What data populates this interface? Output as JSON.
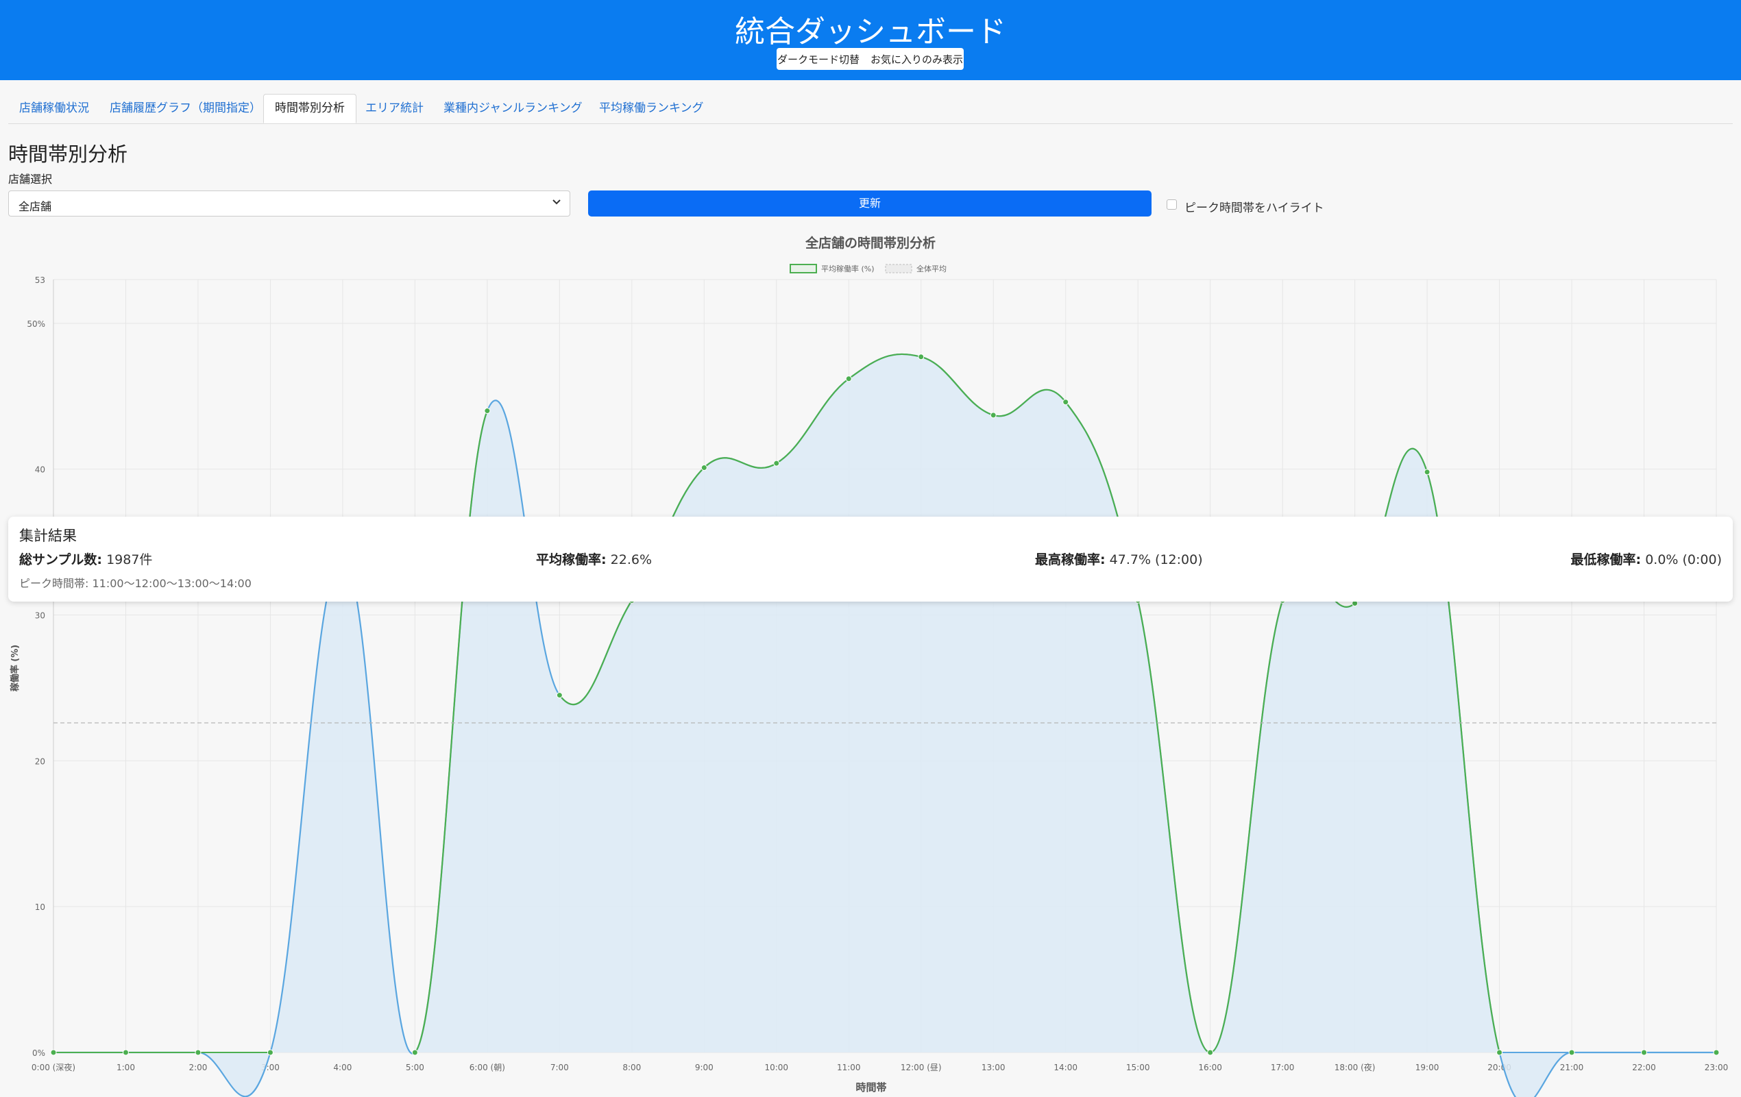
{
  "header": {
    "title": "統合ダッシュボード",
    "dark_mode_label": "ダークモード切替",
    "favorites_label": "お気に入りのみ表示"
  },
  "tabs": [
    {
      "label": "店舗稼働状況",
      "active": false
    },
    {
      "label": "店舗履歴グラフ（期間指定）",
      "active": false
    },
    {
      "label": "時間帯別分析",
      "active": true
    },
    {
      "label": "エリア統計",
      "active": false
    },
    {
      "label": "業種内ジャンルランキング",
      "active": false
    },
    {
      "label": "平均稼働ランキング",
      "active": false
    }
  ],
  "section": {
    "title": "時間帯別分析",
    "store_select_label": "店舗選択",
    "store_select_value": "全店舗",
    "update_button": "更新",
    "peak_highlight_label": "ピーク時間帯をハイライト",
    "peak_highlight_checked": false
  },
  "colors": {
    "header_bg": "#0a7cf0",
    "button_bg": "#0a6cf5",
    "line_green": "#4caf50",
    "line_blue": "#5aa6e0",
    "fill": "#dceaf6"
  },
  "chart_data": {
    "type": "line",
    "title": "全店舗の時間帯別分析",
    "xlabel": "時間帯",
    "ylabel": "稼働率 (%)",
    "x_tick_labels": [
      "0:00 (深夜)",
      "1:00",
      "2:00",
      "3:00",
      "4:00",
      "5:00",
      "6:00 (朝)",
      "7:00",
      "8:00",
      "9:00",
      "10:00",
      "11:00",
      "12:00 (昼)",
      "13:00",
      "14:00",
      "15:00",
      "16:00",
      "17:00",
      "18:00 (夜)",
      "19:00",
      "20:00",
      "21:00",
      "22:00",
      "23:00"
    ],
    "y_tick_labels": [
      {
        "value": 0,
        "label": "0%"
      },
      {
        "value": 10,
        "label": "10"
      },
      {
        "value": 20,
        "label": "20"
      },
      {
        "value": 30,
        "label": "30"
      },
      {
        "value": 40,
        "label": "40"
      },
      {
        "value": 50,
        "label": "50%"
      },
      {
        "value": 53,
        "label": "53"
      }
    ],
    "ylim": [
      0,
      53
    ],
    "series": [
      {
        "name": "平均稼働率 (%)",
        "values": [
          0,
          0,
          0,
          0,
          34,
          0,
          44,
          24.5,
          31,
          40.1,
          40.4,
          46.2,
          47.7,
          43.7,
          44.6,
          31,
          0,
          31,
          30.8,
          39.8,
          0,
          0,
          0,
          0
        ]
      }
    ],
    "reference_lines": [
      {
        "name": "全体平均",
        "value": 22.6
      }
    ],
    "legend_position": "top",
    "grid": true
  },
  "summary": {
    "title": "集計結果",
    "total_samples_label": "総サンプル数:",
    "total_samples_value": "1987件",
    "avg_label": "平均稼働率:",
    "avg_value": "22.6%",
    "max_label": "最高稼働率:",
    "max_value": "47.7% (12:00)",
    "min_label": "最低稼働率:",
    "min_value": "0.0% (0:00)",
    "peak_text": "ピーク時間帯: 11:00〜12:00〜13:00〜14:00"
  }
}
